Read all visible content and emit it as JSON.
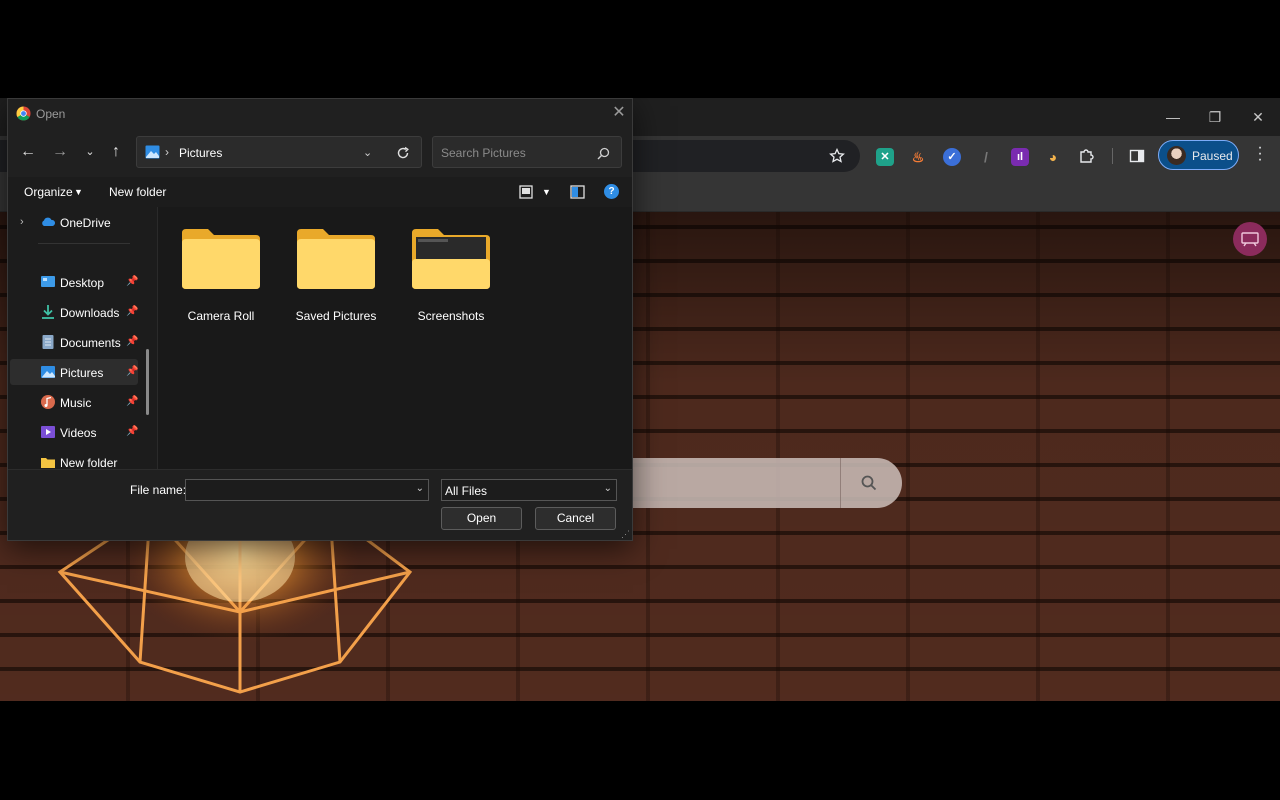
{
  "browser": {
    "window_controls": {
      "minimize": "—",
      "restore": "❐",
      "close": "✕"
    },
    "profile_label": "Paused",
    "extensions": [
      "translate-icon",
      "fire-icon",
      "check-circle-icon",
      "pen-icon",
      "analytics-icon",
      "palette-icon",
      "puzzle-icon"
    ],
    "accent": "#0b4f8a"
  },
  "dialog": {
    "title": "Open",
    "address": {
      "location": "Pictures"
    },
    "search_placeholder": "Search Pictures",
    "commands": {
      "organize": "Organize",
      "new_folder": "New folder"
    },
    "nav_items": [
      {
        "label": "OneDrive",
        "icon": "onedrive-icon",
        "pinned": false
      },
      {
        "label": "Desktop",
        "icon": "desktop-icon",
        "pinned": true
      },
      {
        "label": "Downloads",
        "icon": "download-icon",
        "pinned": true
      },
      {
        "label": "Documents",
        "icon": "document-icon",
        "pinned": true
      },
      {
        "label": "Pictures",
        "icon": "pictures-icon",
        "pinned": true,
        "selected": true
      },
      {
        "label": "Music",
        "icon": "music-icon",
        "pinned": true
      },
      {
        "label": "Videos",
        "icon": "video-icon",
        "pinned": true
      },
      {
        "label": "New folder",
        "icon": "folder-icon",
        "pinned": false
      }
    ],
    "files": [
      {
        "name": "Camera Roll"
      },
      {
        "name": "Saved Pictures"
      },
      {
        "name": "Screenshots"
      }
    ],
    "file_name_label": "File name:",
    "file_name_value": "",
    "file_type": "All Files",
    "open_label": "Open",
    "cancel_label": "Cancel",
    "folder_color": "#f5c542"
  }
}
